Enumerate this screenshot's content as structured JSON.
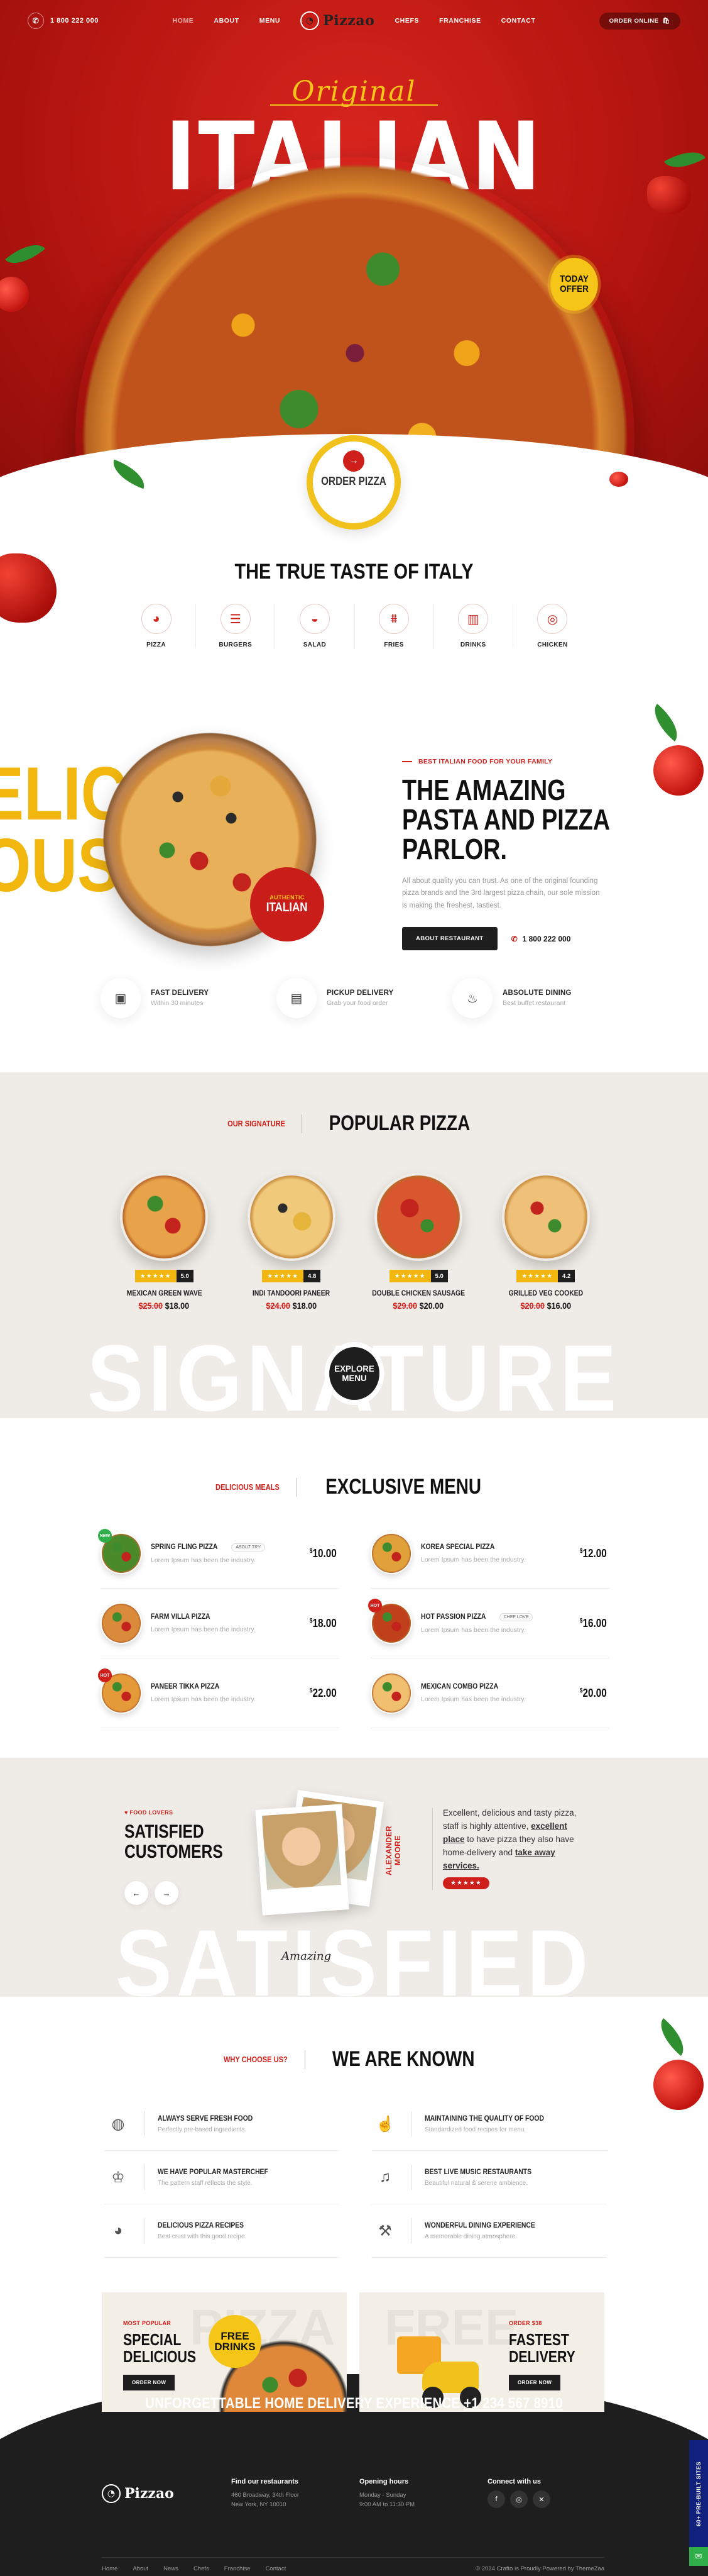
{
  "header": {
    "phone": "1 800 222 000",
    "nav": [
      "HOME",
      "ABOUT",
      "MENU",
      "CHEFS",
      "FRANCHISE",
      "CONTACT"
    ],
    "logo": "Pizzao",
    "order_online": "ORDER ONLINE"
  },
  "hero": {
    "script": "Original",
    "title": "ITALIAN",
    "offer": "TODAY OFFER",
    "order_pizza": "ORDER PIZZA"
  },
  "taste": {
    "title": "THE TRUE TASTE OF ITALY",
    "categories": [
      {
        "label": "PIZZA",
        "icon": "pizza-icon"
      },
      {
        "label": "BURGERS",
        "icon": "burger-icon"
      },
      {
        "label": "SALAD",
        "icon": "salad-icon"
      },
      {
        "label": "FRIES",
        "icon": "fries-icon"
      },
      {
        "label": "DRINKS",
        "icon": "drinks-icon"
      },
      {
        "label": "CHICKEN",
        "icon": "chicken-icon"
      }
    ]
  },
  "amazing": {
    "bg_word": "DELICIOUS",
    "badge_small": "AUTHENTIC",
    "badge_big": "ITALIAN",
    "eyebrow": "BEST ITALIAN FOOD FOR YOUR FAMILY",
    "title": "THE AMAZING PASTA AND PIZZA PARLOR.",
    "description": "All about quality you can trust. As one of the original founding pizza brands and the 3rd largest pizza chain, our sole mission is making the freshest, tastiest.",
    "button": "ABOUT RESTAURANT",
    "phone": "1 800 222 000",
    "features": [
      {
        "title": "FAST DELIVERY",
        "sub": "Within 30 minutes",
        "icon": "box-icon"
      },
      {
        "title": "PICKUP DELIVERY",
        "sub": "Grab your food order",
        "icon": "bag-icon"
      },
      {
        "title": "ABSOLUTE DINING",
        "sub": "Best buffet restaurant",
        "icon": "cloche-icon"
      }
    ]
  },
  "popular": {
    "eyebrow": "OUR SIGNATURE",
    "title": "POPULAR PIZZA",
    "watermark": "SIGNATURE",
    "explore": "EXPLORE MENU",
    "items": [
      {
        "name": "MEXICAN GREEN WAVE",
        "score": "5.0",
        "old": "$25.00",
        "price": "$18.00"
      },
      {
        "name": "INDI TANDOORI PANEER",
        "score": "4.8",
        "old": "$24.00",
        "price": "$18.00"
      },
      {
        "name": "DOUBLE CHICKEN SAUSAGE",
        "score": "5.0",
        "old": "$29.00",
        "price": "$20.00"
      },
      {
        "name": "GRILLED VEG COOKED",
        "score": "4.2",
        "old": "$20.00",
        "price": "$16.00"
      }
    ]
  },
  "menu": {
    "eyebrow": "DELICIOUS MEALS",
    "title": "EXCLUSIVE MENU",
    "items": [
      {
        "name": "SPRING FLING PIZZA",
        "tag": "ABOUT TRY",
        "badge": "NEW",
        "badge_color": "#2fae4a",
        "desc": "Lorem Ipsum has been the industry.",
        "price": "10.00"
      },
      {
        "name": "KOREA SPECIAL PIZZA",
        "tag": "",
        "badge": "",
        "badge_color": "",
        "desc": "Lorem Ipsum has been the industry.",
        "price": "12.00"
      },
      {
        "name": "FARM VILLA PIZZA",
        "tag": "",
        "badge": "",
        "badge_color": "",
        "desc": "Lorem Ipsum has been the industry.",
        "price": "18.00"
      },
      {
        "name": "HOT PASSION PIZZA",
        "tag": "CHEF LOVE",
        "badge": "HOT",
        "badge_color": "#cf1f1a",
        "desc": "Lorem Ipsum has been the industry.",
        "price": "16.00"
      },
      {
        "name": "PANEER TIKKA PIZZA",
        "tag": "",
        "badge": "HOT",
        "badge_color": "#cf1f1a",
        "desc": "Lorem Ipsum has been the industry.",
        "price": "22.00"
      },
      {
        "name": "MEXICAN COMBO PIZZA",
        "tag": "",
        "badge": "",
        "badge_color": "",
        "desc": "Lorem Ipsum has been the industry.",
        "price": "20.00"
      }
    ]
  },
  "satisfied": {
    "eyebrow": "FOOD LOVERS",
    "title": "SATISFIED CUSTOMERS",
    "watermark": "SATISFIED",
    "signature": "Amazing",
    "name": "ALEXANDER MOORE",
    "quote_a": "Excellent, delicious and tasty pizza, staff is highly attentive, ",
    "quote_b": "excellent place",
    "quote_c": " to have pizza they also have home-delivery and ",
    "quote_d": "take away services.",
    "stars": "★★★★★"
  },
  "known": {
    "eyebrow": "WHY CHOOSE US?",
    "title": "WE ARE KNOWN",
    "items": [
      {
        "title": "ALWAYS SERVE FRESH FOOD",
        "sub": "Perfectly pre-based ingredients.",
        "icon": "tomato-icon"
      },
      {
        "title": "MAINTAINING THE QUALITY OF FOOD",
        "sub": "Standardized food recipes for menu.",
        "icon": "thumbs-up-icon"
      },
      {
        "title": "WE HAVE POPULAR MASTERCHEF",
        "sub": "The pattern staff reflects the style.",
        "icon": "chef-hat-icon"
      },
      {
        "title": "BEST LIVE MUSIC RESTAURANTS",
        "sub": "Beautiful natural & serene ambience.",
        "icon": "music-icon"
      },
      {
        "title": "DELICIOUS PIZZA RECIPES",
        "sub": "Best crust with this good recipe.",
        "icon": "pizza-icon"
      },
      {
        "title": "WONDERFUL DINING EXPERIENCE",
        "sub": "A memorable dining atmosphere.",
        "icon": "dining-icon"
      }
    ]
  },
  "promo": {
    "a_eyebrow": "MOST POPULAR",
    "a_title": "SPECIAL DELICIOUS",
    "a_button": "ORDER NOW",
    "a_bg": "PIZZA",
    "a_badge": "FREE DRINKS",
    "b_eyebrow": "ORDER $38",
    "b_title": "FASTEST DELIVERY",
    "b_button": "ORDER NOW",
    "b_bg": "FREE"
  },
  "footer": {
    "delivery_text": "UNFORGETTABLE HOME DELIVERY EXPERIENCE",
    "delivery_phone": "+1 234 567 8910",
    "logo": "Pizzao",
    "find_title": "Find our restaurants",
    "find_line1": "460 Broadway, 34th Floor",
    "find_line2": "New York, NY 10010",
    "hours_title": "Opening hours",
    "hours_line1": "Monday - Sunday",
    "hours_line2": "9:00 AM to 11:30 PM",
    "connect_title": "Connect with us",
    "links": [
      "Home",
      "About",
      "News",
      "Chefs",
      "Franchise",
      "Contact"
    ],
    "copyright": "© 2024 Crafto is Proudly Powered by ThemeZaa",
    "side_tab": "60+ PRE-BUILT SITES"
  }
}
